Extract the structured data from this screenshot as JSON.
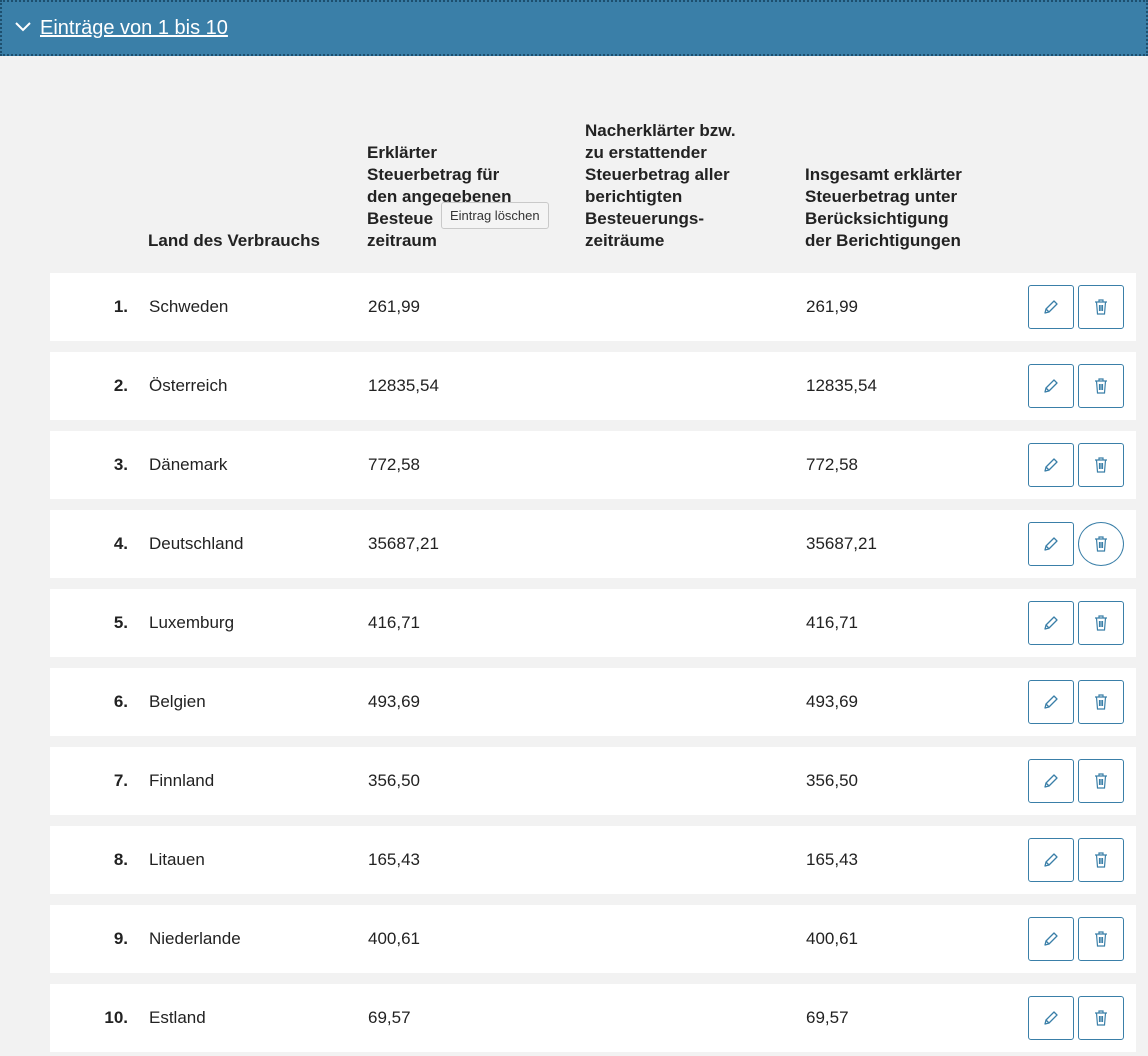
{
  "section": {
    "title": "Einträge von 1 bis 10",
    "icon": "chevron-down-icon"
  },
  "columns": {
    "land": "Land des Verbrauchs",
    "c1": [
      "Erklärter",
      "Steuerbetrag für",
      "den angegebenen",
      "Besteue",
      "zeitraum"
    ],
    "c2": [
      "Nacherklärter bzw.",
      "zu erstattender",
      "Steuerbetrag aller",
      "berichtigten",
      "Besteuerungs-",
      "zeiträume"
    ],
    "c3": [
      "Insgesamt erklärter",
      "Steuerbetrag unter",
      "Berücksichtigung",
      "der Berichtigungen"
    ]
  },
  "tooltip": "Eintrag löschen",
  "rows": [
    {
      "num": "1.",
      "land": "Schweden",
      "v1": "261,99",
      "v2": "",
      "v3": "261,99"
    },
    {
      "num": "2.",
      "land": "Österreich",
      "v1": "12835,54",
      "v2": "",
      "v3": "12835,54"
    },
    {
      "num": "3.",
      "land": "Dänemark",
      "v1": "772,58",
      "v2": "",
      "v3": "772,58"
    },
    {
      "num": "4.",
      "land": "Deutschland",
      "v1": "35687,21",
      "v2": "",
      "v3": "35687,21"
    },
    {
      "num": "5.",
      "land": "Luxemburg",
      "v1": "416,71",
      "v2": "",
      "v3": "416,71"
    },
    {
      "num": "6.",
      "land": "Belgien",
      "v1": "493,69",
      "v2": "",
      "v3": "493,69"
    },
    {
      "num": "7.",
      "land": "Finnland",
      "v1": "356,50",
      "v2": "",
      "v3": "356,50"
    },
    {
      "num": "8.",
      "land": "Litauen",
      "v1": "165,43",
      "v2": "",
      "v3": "165,43"
    },
    {
      "num": "9.",
      "land": "Niederlande",
      "v1": "400,61",
      "v2": "",
      "v3": "400,61"
    },
    {
      "num": "10.",
      "land": "Estland",
      "v1": "69,57",
      "v2": "",
      "v3": "69,57"
    }
  ],
  "icons": {
    "edit": "pencil-icon",
    "delete": "trash-icon"
  },
  "colors": {
    "header_bg": "#3a7fa8",
    "accent": "#3a7fa8",
    "row_bg": "#ffffff",
    "page_bg": "#f2f2f2"
  }
}
